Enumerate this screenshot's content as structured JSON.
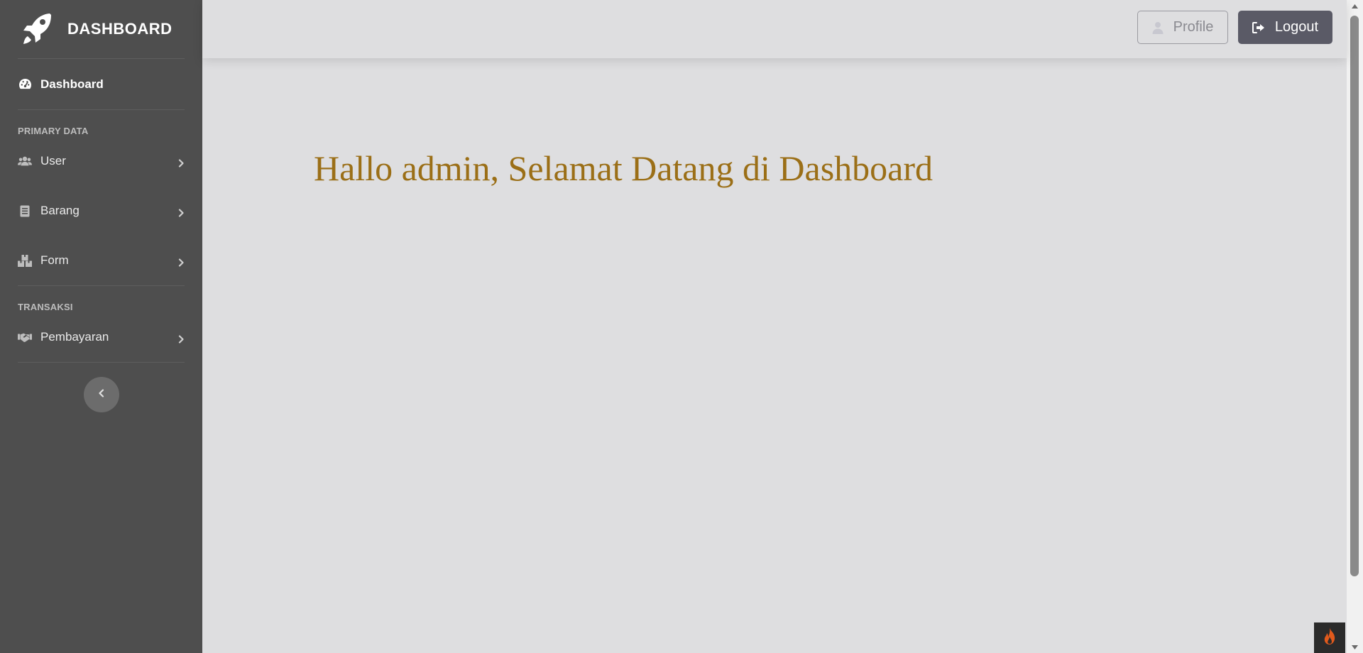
{
  "brand": {
    "title": "DASHBOARD",
    "icon": "rocket-icon"
  },
  "sidebar": {
    "dashboard": {
      "label": "Dashboard",
      "icon": "gauge-icon"
    },
    "sections": [
      {
        "heading": "PRIMARY DATA",
        "items": [
          {
            "label": "User",
            "icon": "users-icon"
          },
          {
            "label": "Barang",
            "icon": "document-icon"
          },
          {
            "label": "Form",
            "icon": "boxes-icon"
          }
        ]
      },
      {
        "heading": "TRANSAKSI",
        "items": [
          {
            "label": "Pembayaran",
            "icon": "handshake-icon"
          }
        ]
      }
    ],
    "toggle_icon": "chevron-left-icon"
  },
  "topbar": {
    "profile_label": "Profile",
    "logout_label": "Logout"
  },
  "main": {
    "greeting": "Hallo admin, Selamat Datang di Dashboard"
  },
  "colors": {
    "sidebar_bg": "#4e4e4e",
    "content_bg": "#dedee0",
    "greeting": "#9b6f17",
    "logout_bg": "#5a5a66"
  }
}
